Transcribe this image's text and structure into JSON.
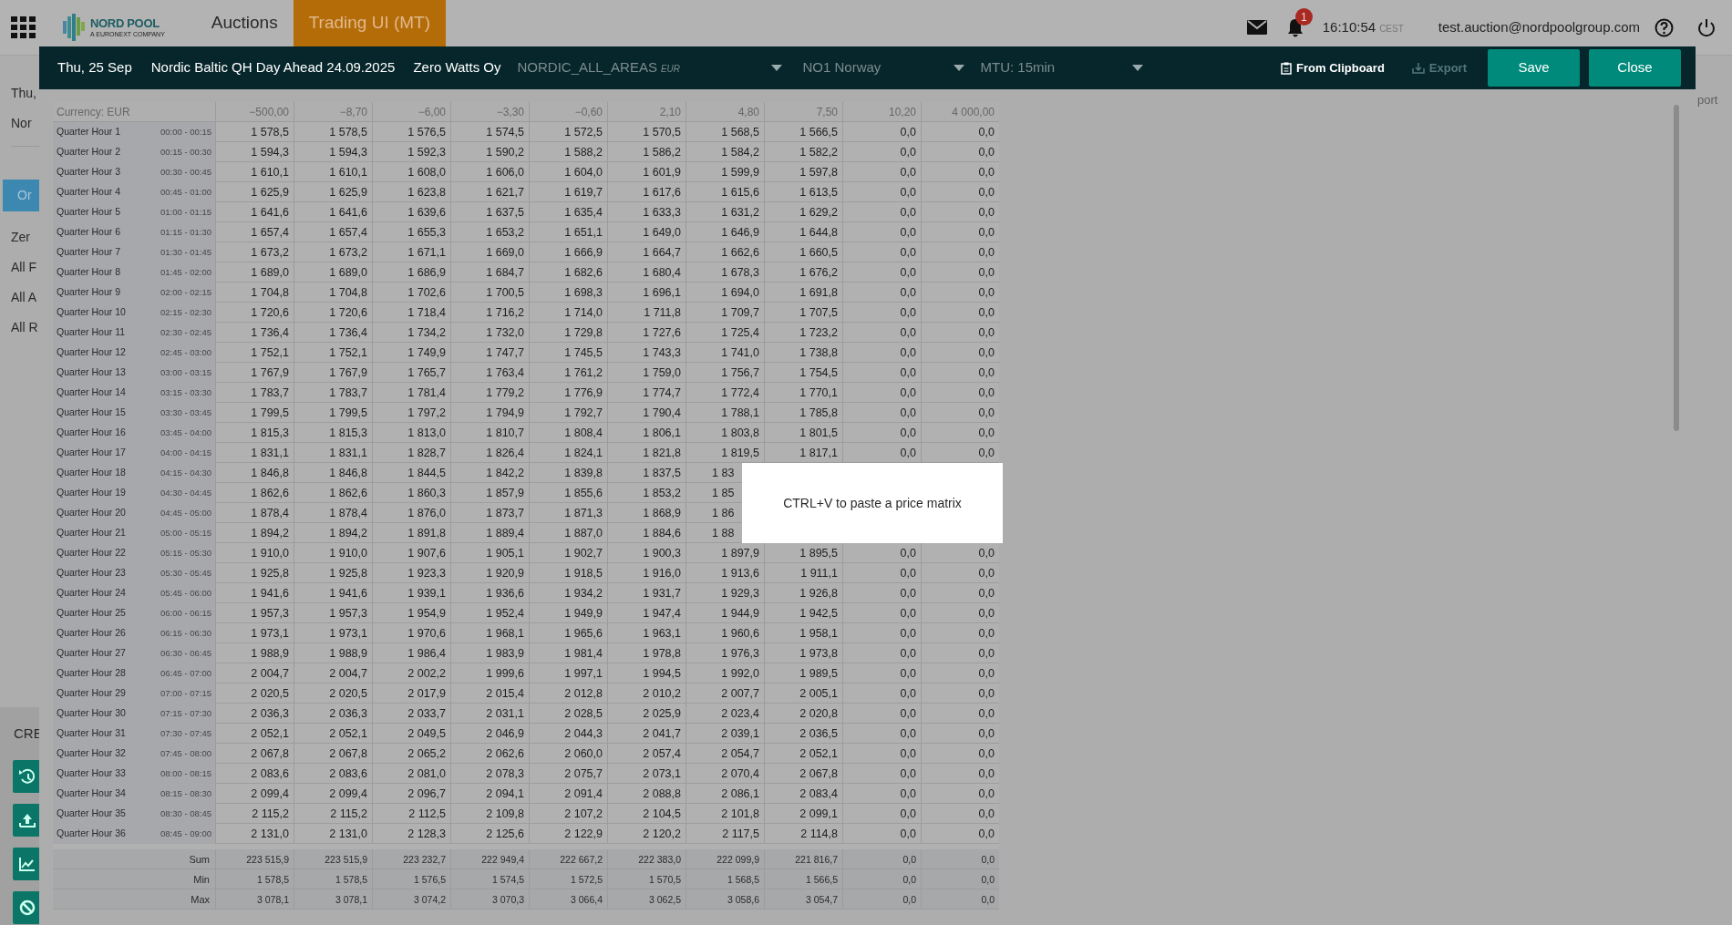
{
  "top_bar": {
    "logo": {
      "name": "NORD POOL",
      "tagline": "A EURONEXT COMPANY"
    },
    "nav": [
      {
        "label": "Auctions",
        "selected": false
      },
      {
        "label": "Trading UI (MT)",
        "selected": true
      }
    ],
    "notification_count": "1",
    "time": "16:10:54",
    "timezone": "CEST",
    "user": "test.auction@nordpoolgroup.com"
  },
  "background": {
    "texts": [
      "Thu,",
      "Nor"
    ],
    "button": "Or",
    "filters": [
      "Zer",
      "All F",
      "All A",
      "All R"
    ],
    "section": "CRE",
    "right_text": "port"
  },
  "modal": {
    "date": "Thu, 25 Sep",
    "auction": "Nordic Baltic QH Day Ahead 24.09.2025",
    "company": "Zero Watts Oy",
    "area_select": {
      "value": "NORDIC_ALL_AREAS",
      "currency": "EUR"
    },
    "zone_select": "NO1 Norway",
    "mtu_select": "MTU: 15min",
    "buttons": [
      {
        "label": "From Clipboard",
        "kind": "clipboard",
        "disabled": false
      },
      {
        "label": "Export",
        "kind": "export",
        "disabled": true
      },
      {
        "label": "Save",
        "kind": "primary",
        "disabled": false
      },
      {
        "label": "Close",
        "kind": "primary",
        "disabled": false
      }
    ]
  },
  "table": {
    "currency": "Currency: EUR",
    "columns": [
      "−500,00",
      "−8,70",
      "−6,00",
      "−3,30",
      "−0,60",
      "2,10",
      "4,80",
      "7,50",
      "10,20",
      "4 000,00"
    ],
    "rows": [
      {
        "label": "Quarter Hour 1",
        "time": "00:00 - 00:15",
        "values": [
          "1 578,5",
          "1 578,5",
          "1 576,5",
          "1 574,5",
          "1 572,5",
          "1 570,5",
          "1 568,5",
          "1 566,5",
          "0,0",
          "0,0"
        ]
      },
      {
        "label": "Quarter Hour 2",
        "time": "00:15 - 00:30",
        "values": [
          "1 594,3",
          "1 594,3",
          "1 592,3",
          "1 590,2",
          "1 588,2",
          "1 586,2",
          "1 584,2",
          "1 582,2",
          "0,0",
          "0,0"
        ]
      },
      {
        "label": "Quarter Hour 3",
        "time": "00:30 - 00:45",
        "values": [
          "1 610,1",
          "1 610,1",
          "1 608,0",
          "1 606,0",
          "1 604,0",
          "1 601,9",
          "1 599,9",
          "1 597,8",
          "0,0",
          "0,0"
        ]
      },
      {
        "label": "Quarter Hour 4",
        "time": "00:45 - 01:00",
        "values": [
          "1 625,9",
          "1 625,9",
          "1 623,8",
          "1 621,7",
          "1 619,7",
          "1 617,6",
          "1 615,6",
          "1 613,5",
          "0,0",
          "0,0"
        ]
      },
      {
        "label": "Quarter Hour 5",
        "time": "01:00 - 01:15",
        "values": [
          "1 641,6",
          "1 641,6",
          "1 639,6",
          "1 637,5",
          "1 635,4",
          "1 633,3",
          "1 631,2",
          "1 629,2",
          "0,0",
          "0,0"
        ]
      },
      {
        "label": "Quarter Hour 6",
        "time": "01:15 - 01:30",
        "values": [
          "1 657,4",
          "1 657,4",
          "1 655,3",
          "1 653,2",
          "1 651,1",
          "1 649,0",
          "1 646,9",
          "1 644,8",
          "0,0",
          "0,0"
        ]
      },
      {
        "label": "Quarter Hour 7",
        "time": "01:30 - 01:45",
        "values": [
          "1 673,2",
          "1 673,2",
          "1 671,1",
          "1 669,0",
          "1 666,9",
          "1 664,7",
          "1 662,6",
          "1 660,5",
          "0,0",
          "0,0"
        ]
      },
      {
        "label": "Quarter Hour 8",
        "time": "01:45 - 02:00",
        "values": [
          "1 689,0",
          "1 689,0",
          "1 686,9",
          "1 684,7",
          "1 682,6",
          "1 680,4",
          "1 678,3",
          "1 676,2",
          "0,0",
          "0,0"
        ]
      },
      {
        "label": "Quarter Hour 9",
        "time": "02:00 - 02:15",
        "values": [
          "1 704,8",
          "1 704,8",
          "1 702,6",
          "1 700,5",
          "1 698,3",
          "1 696,1",
          "1 694,0",
          "1 691,8",
          "0,0",
          "0,0"
        ]
      },
      {
        "label": "Quarter Hour 10",
        "time": "02:15 - 02:30",
        "values": [
          "1 720,6",
          "1 720,6",
          "1 718,4",
          "1 716,2",
          "1 714,0",
          "1 711,8",
          "1 709,7",
          "1 707,5",
          "0,0",
          "0,0"
        ]
      },
      {
        "label": "Quarter Hour 11",
        "time": "02:30 - 02:45",
        "values": [
          "1 736,4",
          "1 736,4",
          "1 734,2",
          "1 732,0",
          "1 729,8",
          "1 727,6",
          "1 725,4",
          "1 723,2",
          "0,0",
          "0,0"
        ]
      },
      {
        "label": "Quarter Hour 12",
        "time": "02:45 - 03:00",
        "values": [
          "1 752,1",
          "1 752,1",
          "1 749,9",
          "1 747,7",
          "1 745,5",
          "1 743,3",
          "1 741,0",
          "1 738,8",
          "0,0",
          "0,0"
        ]
      },
      {
        "label": "Quarter Hour 13",
        "time": "03:00 - 03:15",
        "values": [
          "1 767,9",
          "1 767,9",
          "1 765,7",
          "1 763,4",
          "1 761,2",
          "1 759,0",
          "1 756,7",
          "1 754,5",
          "0,0",
          "0,0"
        ]
      },
      {
        "label": "Quarter Hour 14",
        "time": "03:15 - 03:30",
        "values": [
          "1 783,7",
          "1 783,7",
          "1 781,4",
          "1 779,2",
          "1 776,9",
          "1 774,7",
          "1 772,4",
          "1 770,1",
          "0,0",
          "0,0"
        ]
      },
      {
        "label": "Quarter Hour 15",
        "time": "03:30 - 03:45",
        "values": [
          "1 799,5",
          "1 799,5",
          "1 797,2",
          "1 794,9",
          "1 792,7",
          "1 790,4",
          "1 788,1",
          "1 785,8",
          "0,0",
          "0,0"
        ]
      },
      {
        "label": "Quarter Hour 16",
        "time": "03:45 - 04:00",
        "values": [
          "1 815,3",
          "1 815,3",
          "1 813,0",
          "1 810,7",
          "1 808,4",
          "1 806,1",
          "1 803,8",
          "1 801,5",
          "0,0",
          "0,0"
        ]
      },
      {
        "label": "Quarter Hour 17",
        "time": "04:00 - 04:15",
        "values": [
          "1 831,1",
          "1 831,1",
          "1 828,7",
          "1 826,4",
          "1 824,1",
          "1 821,8",
          "1 819,5",
          "1 817,1",
          "0,0",
          "0,0"
        ]
      },
      {
        "label": "Quarter Hour 18",
        "time": "04:15 - 04:30",
        "cut": true,
        "values": [
          "1 846,8",
          "1 846,8",
          "1 844,5",
          "1 842,2",
          "1 839,8",
          "1 837,5",
          "1 83"
        ]
      },
      {
        "label": "Quarter Hour 19",
        "time": "04:30 - 04:45",
        "cut": true,
        "values": [
          "1 862,6",
          "1 862,6",
          "1 860,3",
          "1 857,9",
          "1 855,6",
          "1 853,2",
          "1 85"
        ]
      },
      {
        "label": "Quarter Hour 20",
        "time": "04:45 - 05:00",
        "cut": true,
        "values": [
          "1 878,4",
          "1 878,4",
          "1 876,0",
          "1 873,7",
          "1 871,3",
          "1 868,9",
          "1 86"
        ]
      },
      {
        "label": "Quarter Hour 21",
        "time": "05:00 - 05:15",
        "cut": true,
        "values": [
          "1 894,2",
          "1 894,2",
          "1 891,8",
          "1 889,4",
          "1 887,0",
          "1 884,6",
          "1 88"
        ]
      },
      {
        "label": "Quarter Hour 22",
        "time": "05:15 - 05:30",
        "values": [
          "1 910,0",
          "1 910,0",
          "1 907,6",
          "1 905,1",
          "1 902,7",
          "1 900,3",
          "1 897,9",
          "1 895,5",
          "0,0",
          "0,0"
        ]
      },
      {
        "label": "Quarter Hour 23",
        "time": "05:30 - 05:45",
        "values": [
          "1 925,8",
          "1 925,8",
          "1 923,3",
          "1 920,9",
          "1 918,5",
          "1 916,0",
          "1 913,6",
          "1 911,1",
          "0,0",
          "0,0"
        ]
      },
      {
        "label": "Quarter Hour 24",
        "time": "05:45 - 06:00",
        "values": [
          "1 941,6",
          "1 941,6",
          "1 939,1",
          "1 936,6",
          "1 934,2",
          "1 931,7",
          "1 929,3",
          "1 926,8",
          "0,0",
          "0,0"
        ]
      },
      {
        "label": "Quarter Hour 25",
        "time": "06:00 - 06:15",
        "values": [
          "1 957,3",
          "1 957,3",
          "1 954,9",
          "1 952,4",
          "1 949,9",
          "1 947,4",
          "1 944,9",
          "1 942,5",
          "0,0",
          "0,0"
        ]
      },
      {
        "label": "Quarter Hour 26",
        "time": "06:15 - 06:30",
        "values": [
          "1 973,1",
          "1 973,1",
          "1 970,6",
          "1 968,1",
          "1 965,6",
          "1 963,1",
          "1 960,6",
          "1 958,1",
          "0,0",
          "0,0"
        ]
      },
      {
        "label": "Quarter Hour 27",
        "time": "06:30 - 06:45",
        "values": [
          "1 988,9",
          "1 988,9",
          "1 986,4",
          "1 983,9",
          "1 981,4",
          "1 978,8",
          "1 976,3",
          "1 973,8",
          "0,0",
          "0,0"
        ]
      },
      {
        "label": "Quarter Hour 28",
        "time": "06:45 - 07:00",
        "values": [
          "2 004,7",
          "2 004,7",
          "2 002,2",
          "1 999,6",
          "1 997,1",
          "1 994,5",
          "1 992,0",
          "1 989,5",
          "0,0",
          "0,0"
        ]
      },
      {
        "label": "Quarter Hour 29",
        "time": "07:00 - 07:15",
        "values": [
          "2 020,5",
          "2 020,5",
          "2 017,9",
          "2 015,4",
          "2 012,8",
          "2 010,2",
          "2 007,7",
          "2 005,1",
          "0,0",
          "0,0"
        ]
      },
      {
        "label": "Quarter Hour 30",
        "time": "07:15 - 07:30",
        "values": [
          "2 036,3",
          "2 036,3",
          "2 033,7",
          "2 031,1",
          "2 028,5",
          "2 025,9",
          "2 023,4",
          "2 020,8",
          "0,0",
          "0,0"
        ]
      },
      {
        "label": "Quarter Hour 31",
        "time": "07:30 - 07:45",
        "values": [
          "2 052,1",
          "2 052,1",
          "2 049,5",
          "2 046,9",
          "2 044,3",
          "2 041,7",
          "2 039,1",
          "2 036,5",
          "0,0",
          "0,0"
        ]
      },
      {
        "label": "Quarter Hour 32",
        "time": "07:45 - 08:00",
        "values": [
          "2 067,8",
          "2 067,8",
          "2 065,2",
          "2 062,6",
          "2 060,0",
          "2 057,4",
          "2 054,7",
          "2 052,1",
          "0,0",
          "0,0"
        ]
      },
      {
        "label": "Quarter Hour 33",
        "time": "08:00 - 08:15",
        "values": [
          "2 083,6",
          "2 083,6",
          "2 081,0",
          "2 078,3",
          "2 075,7",
          "2 073,1",
          "2 070,4",
          "2 067,8",
          "0,0",
          "0,0"
        ]
      },
      {
        "label": "Quarter Hour 34",
        "time": "08:15 - 08:30",
        "values": [
          "2 099,4",
          "2 099,4",
          "2 096,7",
          "2 094,1",
          "2 091,4",
          "2 088,8",
          "2 086,1",
          "2 083,4",
          "0,0",
          "0,0"
        ]
      },
      {
        "label": "Quarter Hour 35",
        "time": "08:30 - 08:45",
        "values": [
          "2 115,2",
          "2 115,2",
          "2 112,5",
          "2 109,8",
          "2 107,2",
          "2 104,5",
          "2 101,8",
          "2 099,1",
          "0,0",
          "0,0"
        ]
      },
      {
        "label": "Quarter Hour 36",
        "time": "08:45 - 09:00",
        "values": [
          "2 131,0",
          "2 131,0",
          "2 128,3",
          "2 125,6",
          "2 122,9",
          "2 120,2",
          "2 117,5",
          "2 114,8",
          "0,0",
          "0,0"
        ]
      }
    ],
    "summary": [
      {
        "label": "Sum",
        "values": [
          "223 515,9",
          "223 515,9",
          "223 232,7",
          "222 949,4",
          "222 667,2",
          "222 383,0",
          "222 099,9",
          "221 816,7",
          "0,0",
          "0,0"
        ]
      },
      {
        "label": "Min",
        "values": [
          "1 578,5",
          "1 578,5",
          "1 576,5",
          "1 574,5",
          "1 572,5",
          "1 570,5",
          "1 568,5",
          "1 566,5",
          "0,0",
          "0,0"
        ]
      },
      {
        "label": "Max",
        "values": [
          "3 078,1",
          "3 078,1",
          "3 074,2",
          "3 070,3",
          "3 066,4",
          "3 062,5",
          "3 058,6",
          "3 054,7",
          "0,0",
          "0,0"
        ]
      }
    ]
  },
  "popup": "CTRL+V to paste a price matrix"
}
